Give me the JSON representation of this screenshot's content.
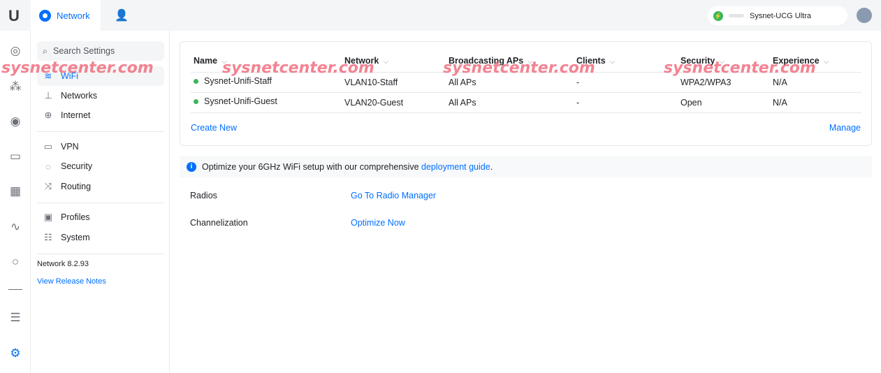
{
  "topbar": {
    "logo": "U",
    "app": "Network",
    "device": "Sysnet-UCG Ultra"
  },
  "search": {
    "placeholder": "Search Settings"
  },
  "nav": {
    "items": [
      {
        "label": "WiFi",
        "icon": "wifi-icon",
        "active": true
      },
      {
        "label": "Networks",
        "icon": "networks-icon"
      },
      {
        "label": "Internet",
        "icon": "globe-icon"
      },
      {
        "label": "VPN",
        "icon": "vpn-icon"
      },
      {
        "label": "Security",
        "icon": "shield-icon"
      },
      {
        "label": "Routing",
        "icon": "routing-icon"
      },
      {
        "label": "Profiles",
        "icon": "profiles-icon"
      },
      {
        "label": "System",
        "icon": "system-icon"
      }
    ],
    "version": "Network 8.2.93",
    "release_notes": "View Release Notes"
  },
  "table": {
    "headers": [
      "Name",
      "Network",
      "Broadcasting APs",
      "Clients",
      "Security",
      "Experience"
    ],
    "rows": [
      [
        "Sysnet-Unifi-Staff",
        "VLAN10-Staff",
        "All APs",
        "-",
        "WPA2/WPA3",
        "N/A"
      ],
      [
        "Sysnet-Unifi-Guest",
        "VLAN20-Guest",
        "All APs",
        "-",
        "Open",
        "N/A"
      ]
    ],
    "create": "Create New",
    "manage": "Manage"
  },
  "info": {
    "text": "Optimize your 6GHz WiFi setup with our comprehensive ",
    "link": "deployment guide",
    "end": "."
  },
  "settings": [
    {
      "label": "Radios",
      "action": "Go To Radio Manager"
    },
    {
      "label": "Channelization",
      "action": "Optimize Now"
    }
  ],
  "watermark": "sysnetcenter.com",
  "colors": {
    "accent": "#006fff",
    "online": "#38b85c"
  }
}
